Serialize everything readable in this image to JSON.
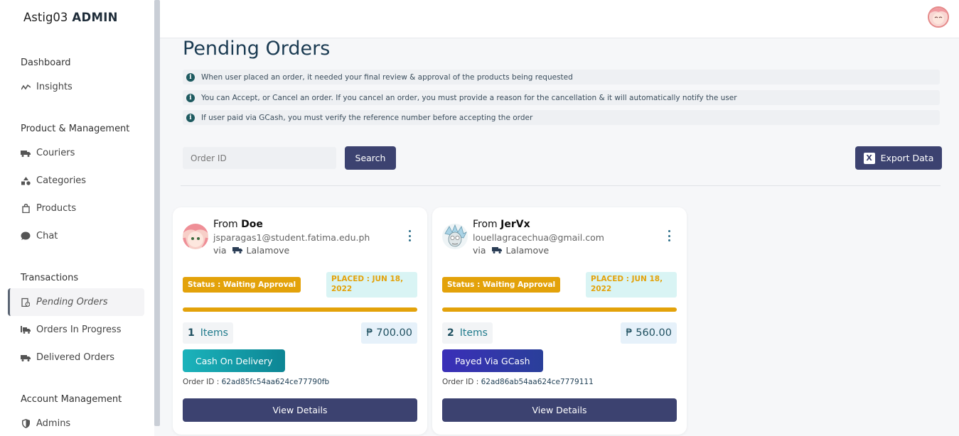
{
  "brand": {
    "name": "Astig03",
    "suffix": "ADMIN"
  },
  "sidebar": {
    "sections": [
      {
        "label": "Dashboard"
      },
      {
        "label": "Product & Management"
      },
      {
        "label": "Transactions"
      },
      {
        "label": "Account Management"
      }
    ],
    "items": [
      {
        "label": "Insights",
        "icon": "chart-line-icon"
      },
      {
        "label": "Couriers",
        "icon": "truck-icon"
      },
      {
        "label": "Categories",
        "icon": "shapes-icon"
      },
      {
        "label": "Products",
        "icon": "shopping-bag-icon"
      },
      {
        "label": "Chat",
        "icon": "chat-bubble-icon"
      },
      {
        "label": "Pending Orders",
        "icon": "clipboard-clock-icon",
        "active": true
      },
      {
        "label": "Orders In Progress",
        "icon": "truck-loading-icon"
      },
      {
        "label": "Delivered Orders",
        "icon": "truck-icon"
      },
      {
        "label": "Admins",
        "icon": "shield-icon"
      }
    ]
  },
  "page": {
    "title": "Pending Orders",
    "notices": [
      "When user placed an order, it needed your final review & approval of the products being requested",
      "You can Accept, or Cancel an order. If you cancel an order, you must provide a reason for the cancellation & it will automatically notify the user",
      "If user paid via GCash, you must verify the reference number before accepting the order"
    ],
    "search": {
      "placeholder": "Order ID",
      "button": "Search"
    },
    "export_button": "Export Data"
  },
  "orders": [
    {
      "from_label": "From",
      "name": "Doe",
      "email": "jsparagas1@student.fatima.edu.ph",
      "via_label": "via",
      "courier": "Lalamove",
      "status": "Status : Waiting Approval",
      "placed": "PLACED : JUN 18, 2022",
      "items_count": "1",
      "items_label": "Items",
      "price": "₱ 700.00",
      "payment": "Cash On Delivery",
      "payment_color": "#17a6b0",
      "order_id_label": "Order ID :",
      "order_id": "62ad85fc54aa624ce77790fb",
      "view_button": "View Details"
    },
    {
      "from_label": "From",
      "name": "JerVx",
      "email": "louellagracechua@gmail.com",
      "via_label": "via",
      "courier": "Lalamove",
      "status": "Status : Waiting Approval",
      "placed": "PLACED : JUN 18, 2022",
      "items_count": "2",
      "items_label": "Items",
      "price": "₱ 560.00",
      "payment": "Payed Via GCash",
      "payment_color": "#3a2fb0",
      "order_id_label": "Order ID :",
      "order_id": "62ad86ab54aa624ce7779111",
      "view_button": "View Details"
    }
  ]
}
